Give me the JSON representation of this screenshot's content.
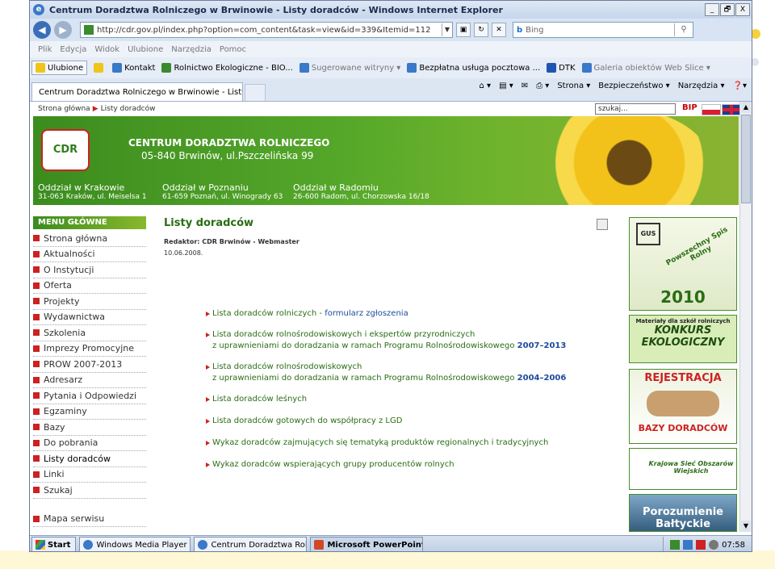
{
  "window": {
    "title": "Centrum Doradztwa Rolniczego w Brwinowie - Listy doradców - Windows Internet Explorer",
    "buttons": [
      "_",
      "🗗",
      "X"
    ]
  },
  "address": {
    "url": "http://cdr.gov.pl/index.php?option=com_content&task=view&id=339&Itemid=112",
    "search_engine": "Bing"
  },
  "menubar": [
    "Plik",
    "Edycja",
    "Widok",
    "Ulubione",
    "Narzędzia",
    "Pomoc"
  ],
  "favorites": {
    "button": "Ulubione",
    "items": [
      {
        "label": "Kontakt",
        "color": "#3a78c8"
      },
      {
        "label": "Rolnictwo Ekologiczne - BIO...",
        "color": "#3a8a2e"
      },
      {
        "label": "Sugerowane witryny ▾",
        "color": "#3a78c8"
      },
      {
        "label": "Bezpłatna usługa pocztowa ...",
        "color": "#3a78c8"
      },
      {
        "label": "DTK",
        "color": "#1f56b0"
      },
      {
        "label": "Galeria obiektów Web Slice ▾",
        "color": "#3a78c8"
      }
    ]
  },
  "tab": {
    "label": "Centrum Doradztwa Rolniczego w Brwinowie - Listy do..."
  },
  "commandbar": [
    "Strona ▾",
    "Bezpieczeństwo ▾",
    "Narzędzia ▾"
  ],
  "page": {
    "breadcrumb": {
      "home": "Strona główna",
      "current": "Listy doradców"
    },
    "site_search_placeholder": "szukaj...",
    "bip": "BIP",
    "header": {
      "logo": "CDR",
      "title": "CENTRUM DORADZTWA ROLNICZEGO",
      "address": "05-840 Brwinów, ul.Pszczelińska 99",
      "branches": [
        {
          "name": "Oddział w Krakowie",
          "address": "31-063 Kraków, ul. Meiselsa 1"
        },
        {
          "name": "Oddział w Poznaniu",
          "address": "61-659 Poznań, ul. Winogrady 63"
        },
        {
          "name": "Oddział w Radomiu",
          "address": "26-600 Radom, ul. Chorzowska 16/18"
        }
      ]
    },
    "menu_title": "MENU GŁÓWNE",
    "menu": [
      "Strona główna",
      "Aktualności",
      "O Instytucji",
      "Oferta",
      "Projekty",
      "Wydawnictwa",
      "Szkolenia",
      "Imprezy Promocyjne",
      "PROW 2007-2013",
      "Adresarz",
      "Pytania i Odpowiedzi",
      "Egzaminy",
      "Bazy",
      "Do pobrania",
      "Listy doradców",
      "Linki",
      "Szukaj"
    ],
    "menu_extra": "Mapa serwisu",
    "content": {
      "title": "Listy doradców",
      "editor": "Redaktor: CDR Brwinów - Webmaster",
      "date": "10.06.2008.",
      "links": [
        {
          "text": "Lista doradców rolniczych - ",
          "link": "formularz zgłoszenia",
          "line2": "",
          "bold": ""
        },
        {
          "text": "Lista doradców rolnośrodowiskowych i ekspertów przyrodniczych",
          "link": "",
          "line2": "z uprawnieniami do doradzania w ramach Programu Rolnośrodowiskowego ",
          "bold": "2007–2013"
        },
        {
          "text": "Lista doradców rolnośrodowiskowych",
          "link": "",
          "line2": "z uprawnieniami do doradzania w ramach Programu Rolnośrodowiskowego ",
          "bold": "2004–2006"
        },
        {
          "text": "Lista doradców leśnych",
          "link": "",
          "line2": "",
          "bold": ""
        },
        {
          "text": "Lista doradców gotowych do współpracy z LGD",
          "link": "",
          "line2": "",
          "bold": ""
        },
        {
          "text": "Wykaz doradców zajmujących się tematyką produktów regionalnych i tradycyjnych",
          "link": "",
          "line2": "",
          "bold": ""
        },
        {
          "text": "Wykaz doradców wspierających grupy producentów rolnych",
          "link": "",
          "line2": "",
          "bold": ""
        }
      ]
    },
    "banners": {
      "gus": "GUS",
      "spis": "Powszechny Spis Rolny",
      "year": "2010",
      "konkurs_small": "Materiały dla szkół rolniczych",
      "konkurs": "KONKURS EKOLOGICZNY",
      "rejestracja": "REJESTRACJA",
      "bazy": "BAZY DORADCÓW",
      "ksow": "Krajowa Sieć Obszarów Wiejskich",
      "porozumienie": "Porozumienie Bałtyckie"
    }
  },
  "taskbar": {
    "start": "Start",
    "buttons": [
      {
        "label": "Windows Media Player",
        "color": "#3a78c8"
      },
      {
        "label": "Centrum Doradztwa Roln...",
        "color": "#3a78c8"
      },
      {
        "label": "Microsoft PowerPoint ...",
        "color": "#d24726"
      }
    ],
    "clock": "07:58"
  }
}
